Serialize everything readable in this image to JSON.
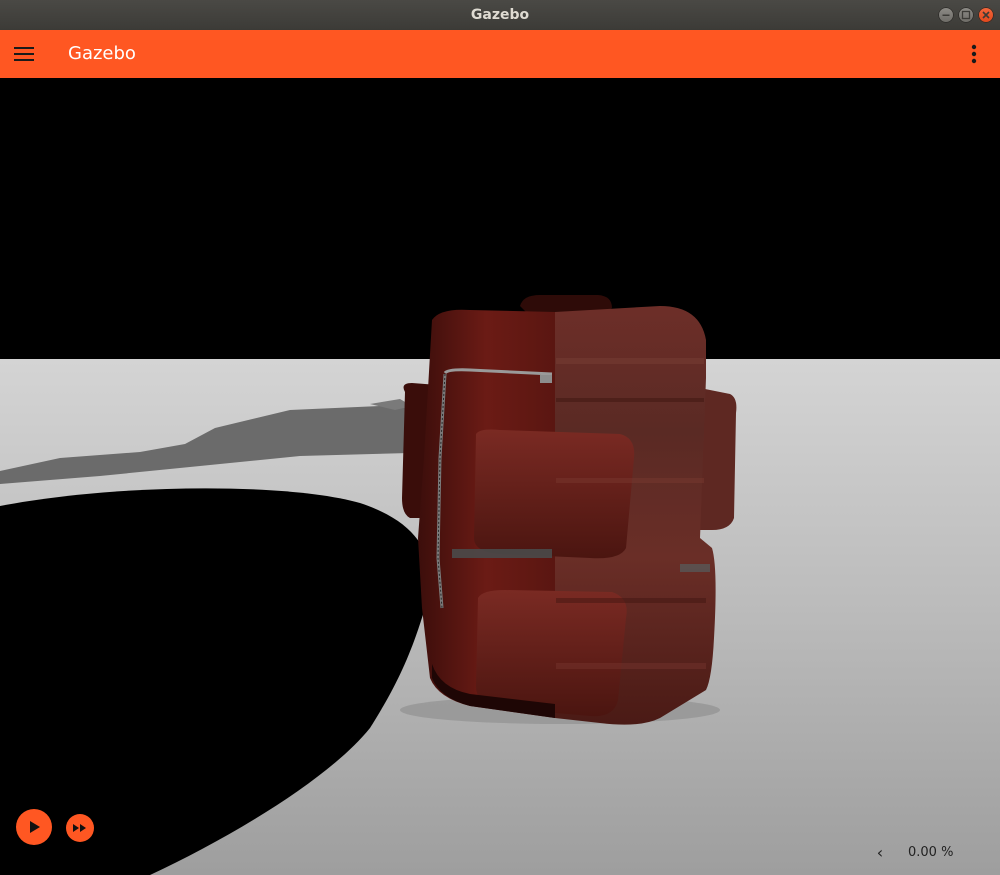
{
  "window": {
    "title": "Gazebo"
  },
  "appbar": {
    "title": "Gazebo",
    "menu_icon": "hamburger-menu-icon",
    "more_icon": "more-vert-icon"
  },
  "scene": {
    "object": "backpack-model"
  },
  "playback": {
    "play_icon": "play-icon",
    "step_icon": "fast-forward-icon"
  },
  "status": {
    "rtf_toggle": "‹",
    "real_time_factor": "0.00 %"
  },
  "colors": {
    "accent": "#ff5722",
    "ground": "#a9a9a9",
    "sky": "#000000",
    "backpack": "#6e1a14"
  }
}
